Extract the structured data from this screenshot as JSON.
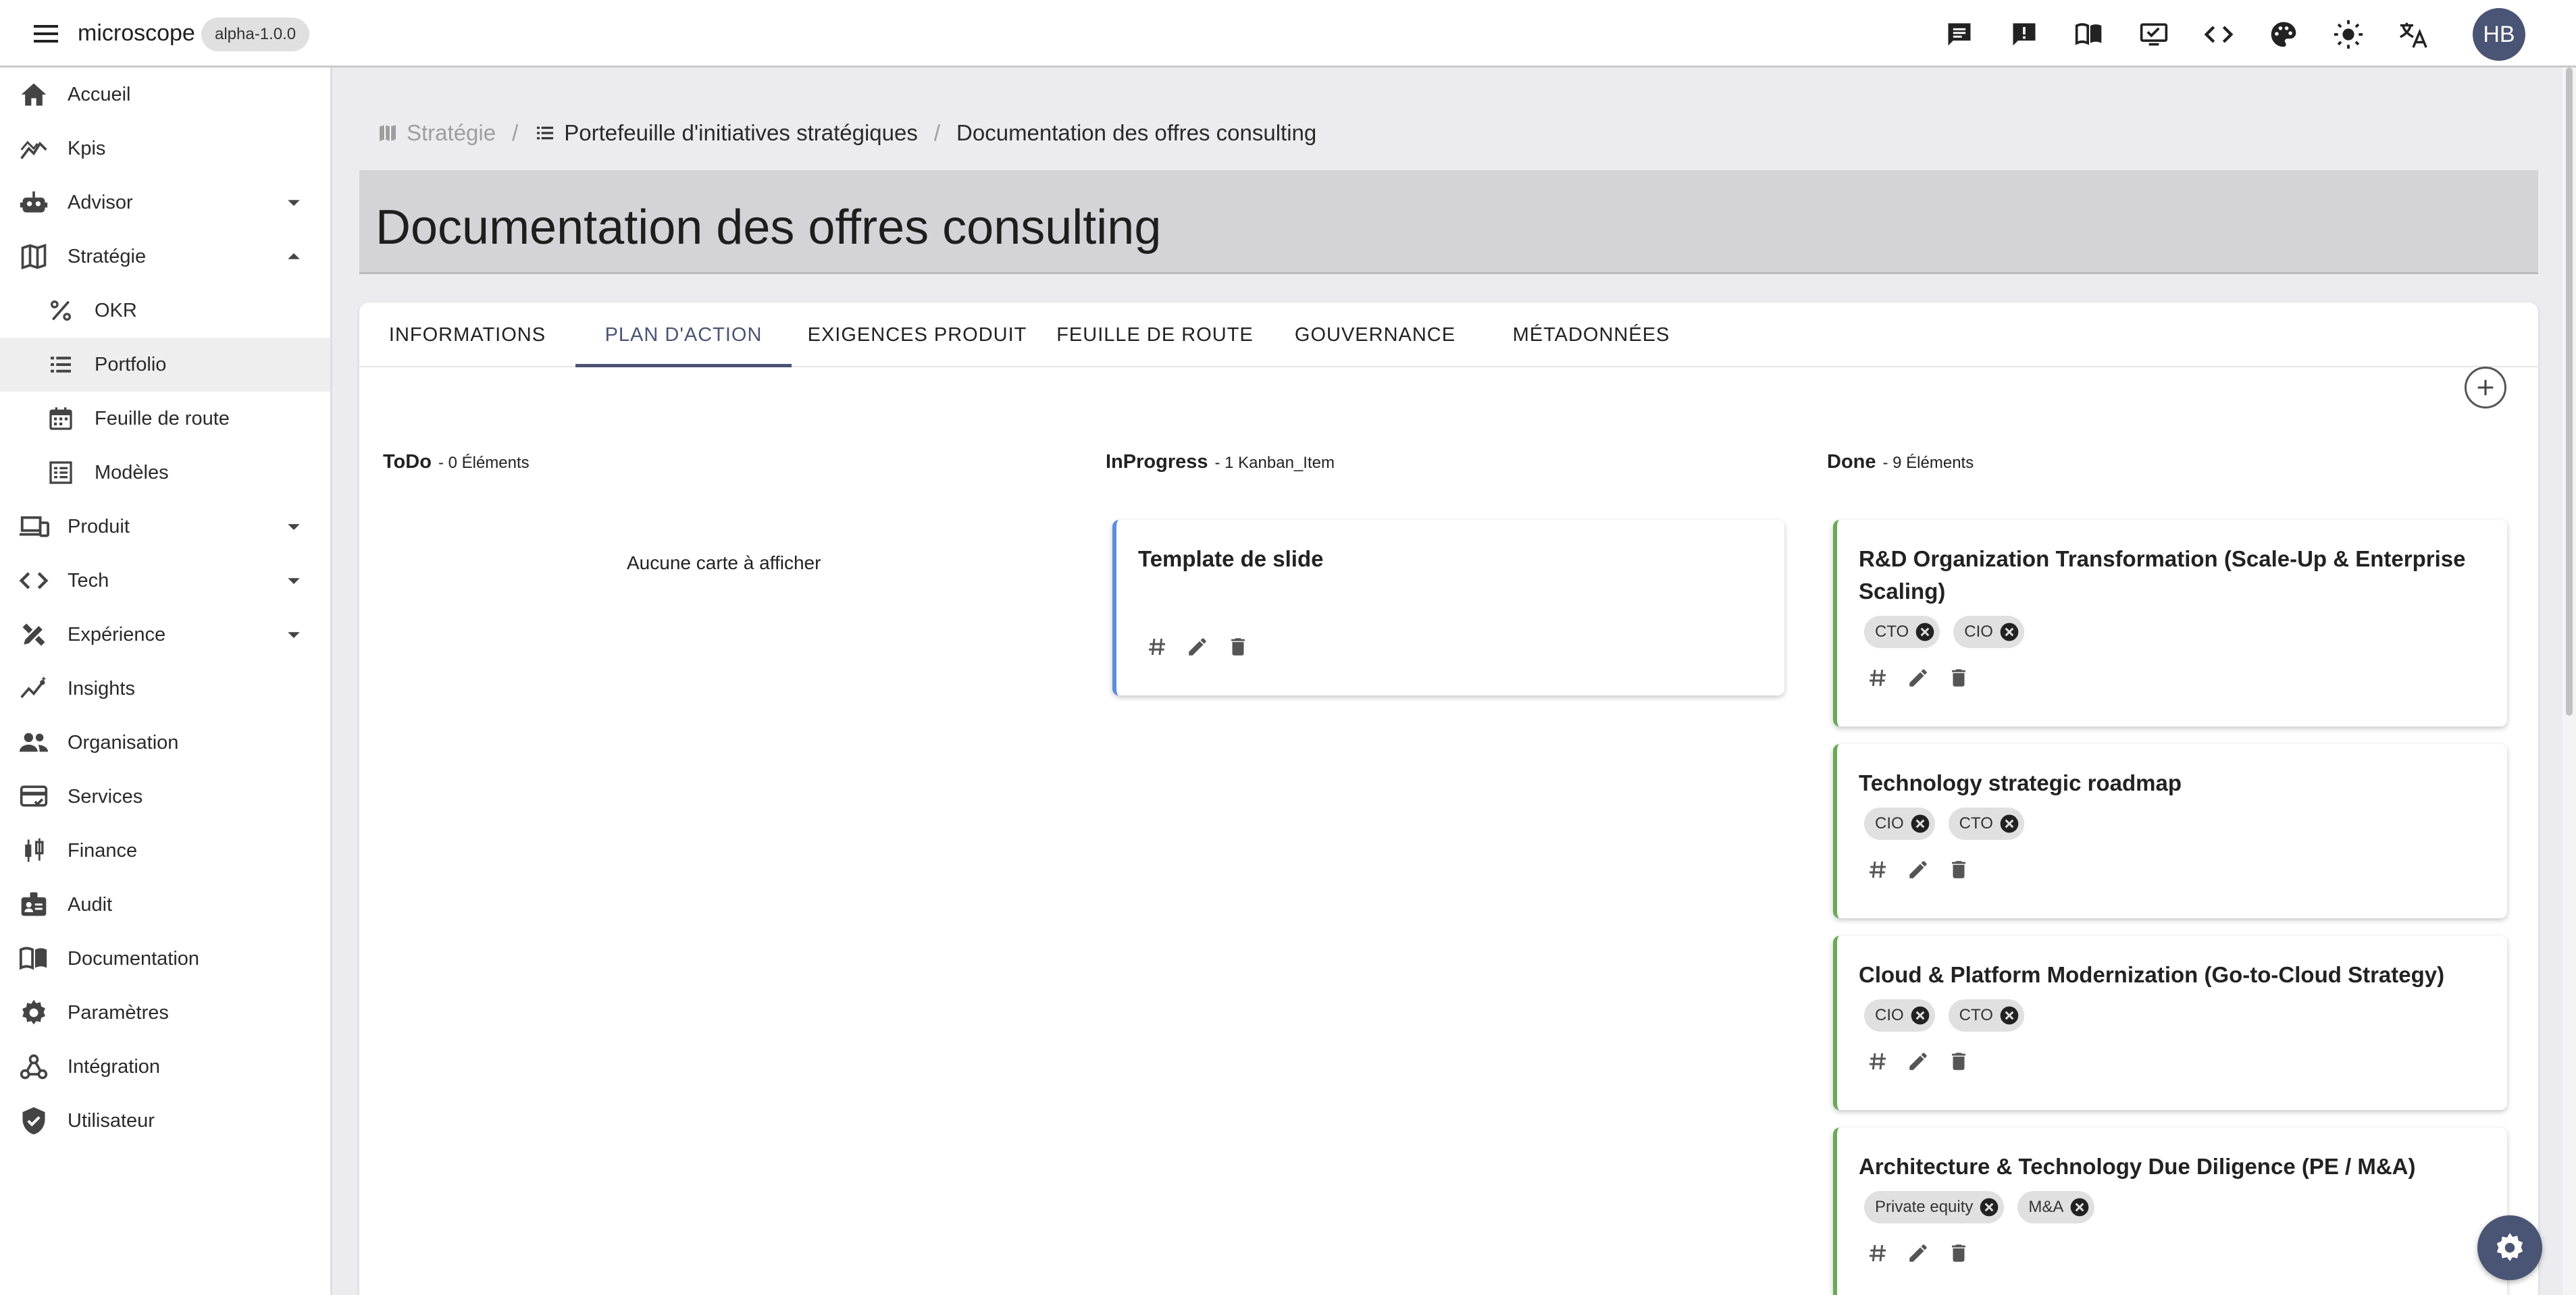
{
  "app": {
    "name": "microscope",
    "version": "alpha-1.0.0",
    "user_initials": "HB",
    "toolbar_icons": [
      "chat-icon",
      "feedback-icon",
      "book-icon",
      "monitor-check-icon",
      "code-icon",
      "palette-icon",
      "brightness-icon",
      "translate-icon"
    ]
  },
  "sidebar": {
    "items": [
      {
        "label": "Accueil",
        "icon": "home-icon"
      },
      {
        "label": "Kpis",
        "icon": "chart-icon"
      },
      {
        "label": "Advisor",
        "icon": "robot-icon",
        "expandable": true
      },
      {
        "label": "Stratégie",
        "icon": "map-icon",
        "expanded": true
      },
      {
        "label": "OKR",
        "icon": "percent-icon",
        "sub": true
      },
      {
        "label": "Portfolio",
        "icon": "list-icon",
        "sub": true,
        "selected": true
      },
      {
        "label": "Feuille de route",
        "icon": "calendar-icon",
        "sub": true
      },
      {
        "label": "Modèles",
        "icon": "template-icon",
        "sub": true
      },
      {
        "label": "Produit",
        "icon": "devices-icon",
        "expandable": true
      },
      {
        "label": "Tech",
        "icon": "code-icon",
        "expandable": true
      },
      {
        "label": "Expérience",
        "icon": "design-icon",
        "expandable": true
      },
      {
        "label": "Insights",
        "icon": "insights-icon"
      },
      {
        "label": "Organisation",
        "icon": "people-icon"
      },
      {
        "label": "Services",
        "icon": "card-check-icon"
      },
      {
        "label": "Finance",
        "icon": "candlestick-icon"
      },
      {
        "label": "Audit",
        "icon": "badge-icon"
      },
      {
        "label": "Documentation",
        "icon": "book-icon"
      },
      {
        "label": "Paramètres",
        "icon": "gear-icon"
      },
      {
        "label": "Intégration",
        "icon": "webhook-icon"
      },
      {
        "label": "Utilisateur",
        "icon": "shield-check-icon"
      }
    ]
  },
  "breadcrumb": {
    "items": [
      {
        "label": "Stratégie",
        "icon": "map-icon"
      },
      {
        "label": "Portefeuille d'initiatives stratégiques",
        "icon": "list-icon"
      },
      {
        "label": "Documentation des offres consulting"
      }
    ]
  },
  "page": {
    "title": "Documentation des offres consulting"
  },
  "tabs": [
    {
      "label": "INFORMATIONS"
    },
    {
      "label": "PLAN D'ACTION",
      "active": true
    },
    {
      "label": "EXIGENCES PRODUIT"
    },
    {
      "label": "FEUILLE DE ROUTE"
    },
    {
      "label": "GOUVERNANCE"
    },
    {
      "label": "MÉTADONNÉES"
    }
  ],
  "kanban": {
    "columns": [
      {
        "name": "ToDo",
        "count": "- 0 Éléments",
        "empty_message": "Aucune carte à afficher",
        "cards": []
      },
      {
        "name": "InProgress",
        "count": "- 1 Kanban_Item",
        "cards": [
          {
            "title": "Template de slide",
            "tags": []
          }
        ]
      },
      {
        "name": "Done",
        "count": "- 9 Éléments",
        "cards": [
          {
            "title": "R&D Organization Transformation (Scale-Up & Enterprise Scaling)",
            "tags": [
              "CTO",
              "CIO"
            ]
          },
          {
            "title": "Technology strategic roadmap",
            "tags": [
              "CIO",
              "CTO"
            ]
          },
          {
            "title": "Cloud & Platform Modernization (Go-to-Cloud Strategy)",
            "tags": [
              "CIO",
              "CTO"
            ]
          },
          {
            "title": "Architecture & Technology Due Diligence (PE / M&A)",
            "tags": [
              "Private equity",
              "M&A"
            ]
          }
        ]
      }
    ]
  },
  "colors": {
    "primary": "#4a5474",
    "in_progress_accent": "#5b8de0",
    "done_accent": "#6aaa55"
  }
}
